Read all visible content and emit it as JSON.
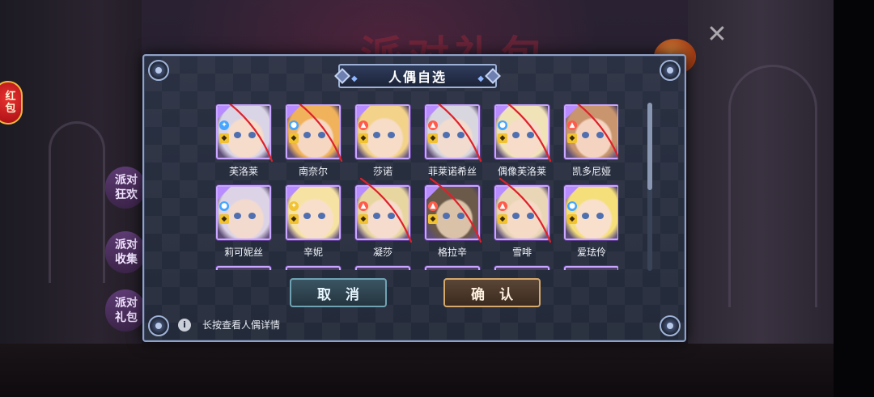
{
  "background": {
    "event_title": "派对礼包",
    "red_packet_label": [
      "红",
      "包"
    ],
    "side_buttons": [
      "派对狂欢",
      "派对收集",
      "派对礼包"
    ],
    "close_icon": "close-icon"
  },
  "dialog": {
    "title": "人偶自选",
    "cancel_label": "取消",
    "confirm_label": "确认",
    "hint_text": "长按查看人偶详情",
    "info_icon": "info-icon"
  },
  "dolls": [
    {
      "name": "芙洛莱",
      "element": "light",
      "element_color": "#46a6ff",
      "rank_color": "#f1c232",
      "hair": "#d9d4e6",
      "skin": "#f5dccb",
      "crossed": true
    },
    {
      "name": "南奈尔",
      "element": "water",
      "element_color": "#46a6ff",
      "rank_color": "#f1c232",
      "hair": "#f0b25a",
      "skin": "#f6d7c2",
      "crossed": true
    },
    {
      "name": "莎诺",
      "element": "fire",
      "element_color": "#ff5a4a",
      "rank_color": "#f1c232",
      "hair": "#f3d38a",
      "skin": "#f7dcc8",
      "crossed": false
    },
    {
      "name": "菲莱诺希丝",
      "element": "fire",
      "element_color": "#ff5a4a",
      "rank_color": "#f1c232",
      "hair": "#d8d6de",
      "skin": "#f2dccf",
      "crossed": true
    },
    {
      "name": "偶像芙洛莱",
      "element": "water",
      "element_color": "#46a6ff",
      "rank_color": "#f1c232",
      "hair": "#f1e3b8",
      "skin": "#f6dcc9",
      "crossed": true
    },
    {
      "name": "凯多尼娅",
      "element": "fire",
      "element_color": "#ff5a4a",
      "rank_color": "#f1c232",
      "hair": "#c8956e",
      "skin": "#f4d4c0",
      "crossed": true
    },
    {
      "name": "莉可妮丝",
      "element": "water",
      "element_color": "#46a6ff",
      "rank_color": "#f1c232",
      "hair": "#dcd3e6",
      "skin": "#f3dace",
      "crossed": false
    },
    {
      "name": "辛妮",
      "element": "light",
      "element_color": "#f1c232",
      "rank_color": "#f1c232",
      "hair": "#f6e3a3",
      "skin": "#f8dfcc",
      "crossed": false
    },
    {
      "name": "凝莎",
      "element": "fire",
      "element_color": "#ff5a4a",
      "rank_color": "#f1c232",
      "hair": "#e8d6a0",
      "skin": "#f6dccc",
      "crossed": true
    },
    {
      "name": "格拉辛",
      "element": "fire",
      "element_color": "#ff5a4a",
      "rank_color": "#f1c232",
      "hair": "#6b5a4a",
      "skin": "#d9c2a8",
      "crossed": true
    },
    {
      "name": "雪啡",
      "element": "fire",
      "element_color": "#ff5a4a",
      "rank_color": "#f1c232",
      "hair": "#e9d6b6",
      "skin": "#f5dac6",
      "crossed": true
    },
    {
      "name": "爱珐伶",
      "element": "water",
      "element_color": "#46a6ff",
      "rank_color": "#f1c232",
      "hair": "#f5df7a",
      "skin": "#f8e0cc",
      "crossed": false
    }
  ],
  "scroll": {
    "visible_fraction": 0.52,
    "position": 0
  }
}
